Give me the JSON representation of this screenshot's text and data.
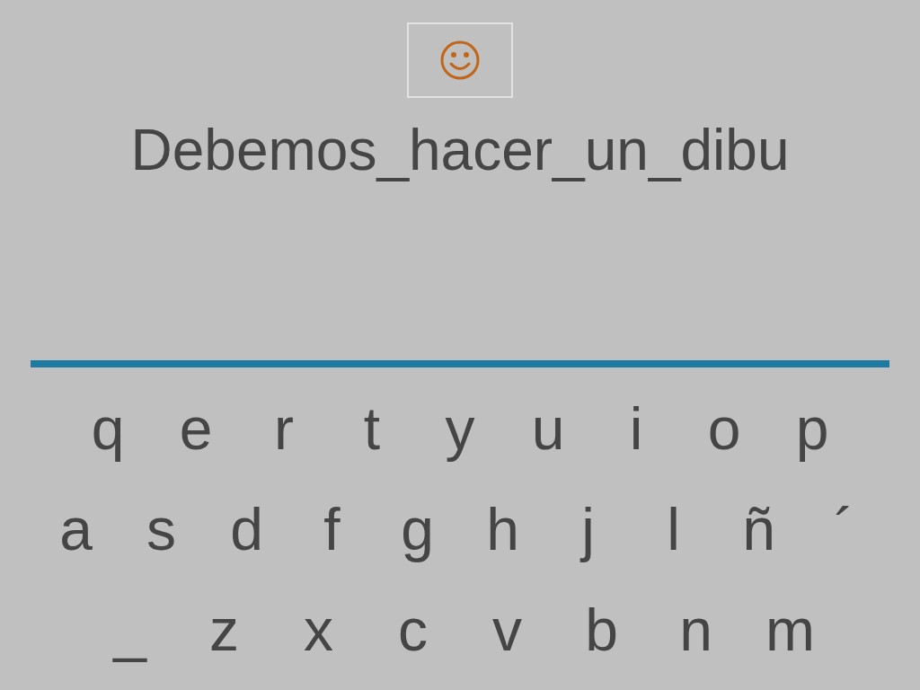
{
  "answer": "Debemos_hacer_un_dibu",
  "keyboard": [
    [
      "q",
      "e",
      "r",
      "t",
      "y",
      "u",
      "i",
      "o",
      "p"
    ],
    [
      "a",
      "s",
      "d",
      "f",
      "g",
      "h",
      "j",
      "l",
      "ñ",
      "´"
    ],
    [
      "_",
      "z",
      "x",
      "c",
      "v",
      "b",
      "n",
      "m"
    ]
  ]
}
